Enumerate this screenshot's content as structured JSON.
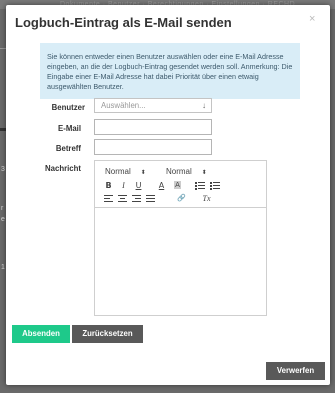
{
  "background": {
    "strip_text": "Dokumente   ·   Benutzer   ·   Berechtigungen   ·   Einstellungen   ·   RECHD",
    "fragments": [
      "3",
      "r",
      "e",
      "1"
    ]
  },
  "modal": {
    "title": "Logbuch-Eintrag als E-Mail senden",
    "close_glyph": "×",
    "info_text": "Sie können entweder einen Benutzer auswählen oder eine E-Mail Adresse eingeben, an die der Logbuch-Eintrag gesendet werden soll. Anmerkung: Die Eingabe einer E-Mail Adresse hat dabei Priorität über einen etwaig ausgewählten Benutzer.",
    "form": {
      "user_label": "Benutzer",
      "user_select_value": "Auswählen...",
      "user_select_caret": "↓",
      "email_label": "E-Mail",
      "email_value": "",
      "subject_label": "Betreff",
      "subject_value": "",
      "message_label": "Nachricht"
    },
    "editor": {
      "format_select": "Normal",
      "size_select": "Normal",
      "select_arrow": "⬍",
      "bold": "B",
      "italic": "I",
      "underline": "U",
      "font_color": "A",
      "bg_color": "A",
      "link": "🔗",
      "clear_format": "Tx",
      "content": ""
    },
    "buttons": {
      "send": "Absenden",
      "reset": "Zurücksetzen",
      "discard": "Verwerfen"
    }
  },
  "colors": {
    "primary": "#1ec98a",
    "secondary": "#595959",
    "info_bg": "#d9edf7"
  }
}
